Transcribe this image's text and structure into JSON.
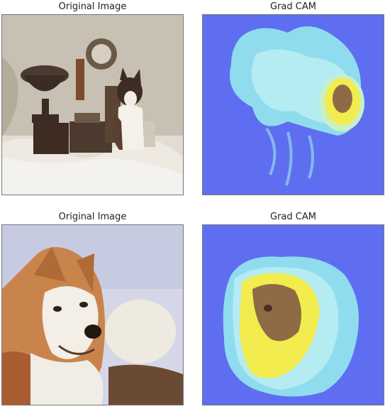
{
  "panels": [
    {
      "title": "Original Image"
    },
    {
      "title": "Grad CAM"
    },
    {
      "title": "Original Image"
    },
    {
      "title": "Grad CAM"
    }
  ],
  "colors": {
    "cam_background": "#5f6ef0",
    "cam_low": "#a6e6f2",
    "cam_mid": "#f2ec4e",
    "cam_high": "#8e6b44"
  }
}
